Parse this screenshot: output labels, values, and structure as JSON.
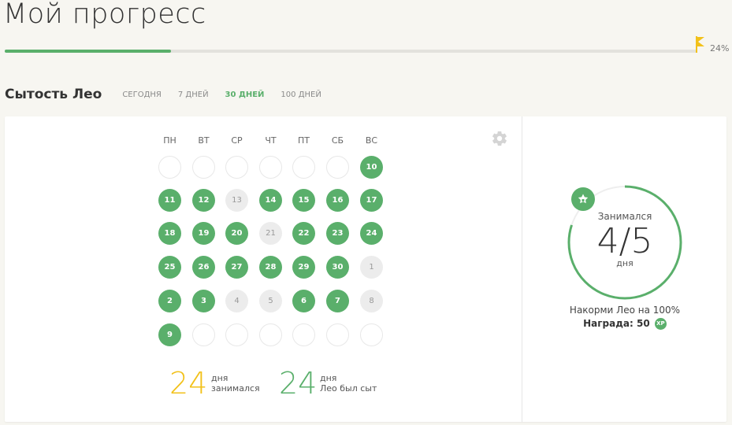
{
  "header": {
    "title": "Мой прогресс",
    "progress_percent": 24,
    "progress_label": "24%"
  },
  "section": {
    "title": "Сытость Лео",
    "tabs": [
      {
        "label": "СЕГОДНЯ",
        "active": false
      },
      {
        "label": "7 ДНЕЙ",
        "active": false
      },
      {
        "label": "30 ДНЕЙ",
        "active": true
      },
      {
        "label": "100 ДНЕЙ",
        "active": false
      }
    ]
  },
  "calendar": {
    "weekdays": [
      "ПН",
      "ВТ",
      "СР",
      "ЧТ",
      "ПТ",
      "СБ",
      "ВС"
    ],
    "weeks": [
      [
        {
          "d": "",
          "s": "empty"
        },
        {
          "d": "",
          "s": "empty"
        },
        {
          "d": "",
          "s": "empty"
        },
        {
          "d": "",
          "s": "empty"
        },
        {
          "d": "",
          "s": "empty"
        },
        {
          "d": "",
          "s": "empty"
        },
        {
          "d": "10",
          "s": "done"
        }
      ],
      [
        {
          "d": "11",
          "s": "done"
        },
        {
          "d": "12",
          "s": "done"
        },
        {
          "d": "13",
          "s": "missed"
        },
        {
          "d": "14",
          "s": "done"
        },
        {
          "d": "15",
          "s": "done"
        },
        {
          "d": "16",
          "s": "done"
        },
        {
          "d": "17",
          "s": "done"
        }
      ],
      [
        {
          "d": "18",
          "s": "done"
        },
        {
          "d": "19",
          "s": "done"
        },
        {
          "d": "20",
          "s": "done"
        },
        {
          "d": "21",
          "s": "missed"
        },
        {
          "d": "22",
          "s": "done"
        },
        {
          "d": "23",
          "s": "done"
        },
        {
          "d": "24",
          "s": "done"
        }
      ],
      [
        {
          "d": "25",
          "s": "done"
        },
        {
          "d": "26",
          "s": "done"
        },
        {
          "d": "27",
          "s": "done"
        },
        {
          "d": "28",
          "s": "done"
        },
        {
          "d": "29",
          "s": "done"
        },
        {
          "d": "30",
          "s": "done"
        },
        {
          "d": "1",
          "s": "missed"
        }
      ],
      [
        {
          "d": "2",
          "s": "done"
        },
        {
          "d": "3",
          "s": "done"
        },
        {
          "d": "4",
          "s": "missed"
        },
        {
          "d": "5",
          "s": "missed"
        },
        {
          "d": "6",
          "s": "done"
        },
        {
          "d": "7",
          "s": "done"
        },
        {
          "d": "8",
          "s": "missed"
        }
      ],
      [
        {
          "d": "9",
          "s": "done"
        },
        {
          "d": "",
          "s": "empty"
        },
        {
          "d": "",
          "s": "empty"
        },
        {
          "d": "",
          "s": "empty"
        },
        {
          "d": "",
          "s": "empty"
        },
        {
          "d": "",
          "s": "empty"
        },
        {
          "d": "",
          "s": "empty"
        }
      ]
    ]
  },
  "stats": {
    "studied": {
      "value": "24",
      "unit": "дня",
      "label": "занимался",
      "color": "#f2c11a"
    },
    "fed": {
      "value": "24",
      "unit": "дня",
      "label": "Лео был сыт",
      "color": "#5aaf6b"
    }
  },
  "goal": {
    "top_label": "Занимался",
    "value": "4/5",
    "unit": "дня",
    "progress_fraction": 0.8,
    "description": "Накорми Лео на 100%",
    "reward_label": "Награда: 50",
    "xp_label": "XP"
  },
  "colors": {
    "green": "#5aaf6b",
    "yellow": "#f2c11a"
  },
  "icons": {
    "gear": "gear-icon",
    "flag": "flag-icon",
    "badge": "star-badge-icon"
  }
}
